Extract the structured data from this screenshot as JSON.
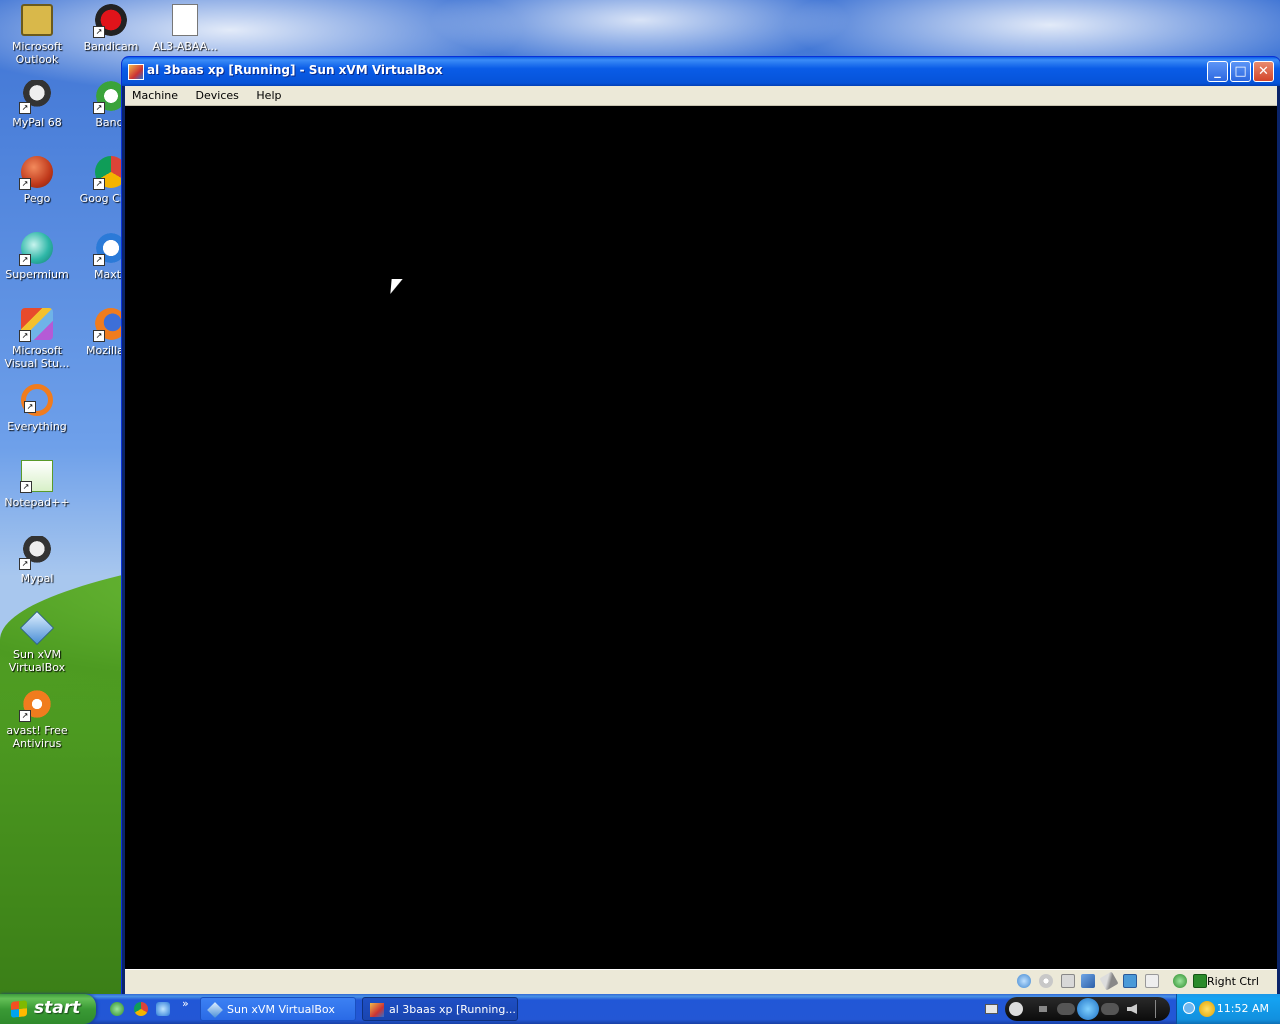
{
  "desktop": {
    "icons": [
      {
        "name": "outlook-icon",
        "label": "Microsoft Outlook"
      },
      {
        "name": "bandicam-icon",
        "label": "Bandicam"
      },
      {
        "name": "document-icon",
        "label": "AL3-ABAA..."
      },
      {
        "name": "mypal68-icon",
        "label": "MyPal 68"
      },
      {
        "name": "bandicut-icon",
        "label": "Bandi"
      },
      {
        "name": "pego-icon",
        "label": "Pego"
      },
      {
        "name": "chrome-icon",
        "label": "Goog Chror"
      },
      {
        "name": "supermium-icon",
        "label": "Supermium"
      },
      {
        "name": "maxthon-icon",
        "label": "Maxth"
      },
      {
        "name": "visual-studio-icon",
        "label": "Microsoft Visual Stu..."
      },
      {
        "name": "firefox-icon",
        "label": "Mozilla Fi"
      },
      {
        "name": "everything-icon",
        "label": "Everything"
      },
      {
        "name": "notepadpp-icon",
        "label": "Notepad++"
      },
      {
        "name": "mypal-icon",
        "label": "Mypal"
      },
      {
        "name": "virtualbox-icon",
        "label": "Sun xVM VirtualBox"
      },
      {
        "name": "avast-icon",
        "label": "avast! Free Antivirus"
      }
    ]
  },
  "window": {
    "title": "al 3baas xp [Running] - Sun xVM VirtualBox",
    "controls": {
      "minimize": "_",
      "maximize": "□",
      "close": "✕"
    },
    "menu": [
      "Machine",
      "Devices",
      "Help"
    ],
    "status": {
      "host_key": "Right Ctrl"
    }
  },
  "taskbar": {
    "start_label": "start",
    "overflow": "»",
    "tasks": [
      {
        "label": "Sun xVM VirtualBox",
        "active": false
      },
      {
        "label": "al 3baas xp [Running...",
        "active": true
      }
    ],
    "clock": "11:52 AM"
  },
  "colors": {
    "titlebar": "#0a5ce7",
    "menubar": "#ece9d8",
    "vm_screen": "#000000",
    "taskbar": "#2357d5",
    "start_button": "#3a9a35"
  }
}
